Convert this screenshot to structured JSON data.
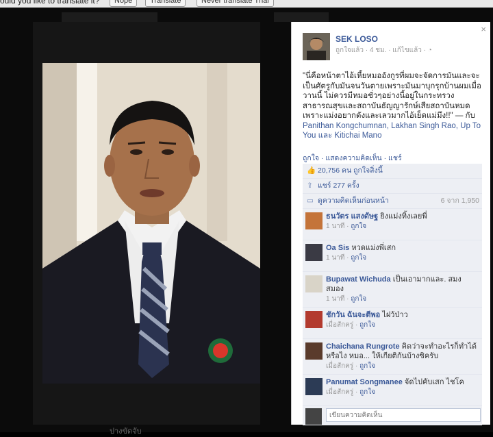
{
  "translate_bar": {
    "question": "ould you like to translate it?",
    "nope": "Nope",
    "translate": "Translate",
    "never": "Never translate Thai"
  },
  "stage": {
    "bottom_text": "ปางขัดจับ"
  },
  "post": {
    "close": "×",
    "author": "SEK LOSO",
    "meta": "ถูกใจแล้ว · 4 ชม. · แก้ไขแล้ว · ◔",
    "caption": "\"นี่คือหน้าตาไอ้เหี้ยหมออังกูรที่ผมจะจัดการมันและจะเป็นศัตรูกับมันจนวันตายเพราะมันมาบุกรุกบ้านผมเมื่อวานนี้ ไม่ควรมีหมอชั่วๆอย่างนี้อยู่ในกระทรวงสาธารณสุขและสถาบันธัญญารักษ์เสียสถาบันหมดเพราะแม่งอยากดังและเลวมากไอ้เย็ดแม่มึง!!\" — กับ",
    "tags": "Panithan Kongchumnan, Lakhan Singh Rao, Up To You และ Kitichai Mano",
    "actions": "ถูกใจ · แสดงความคิดเห็น · แชร์"
  },
  "ufi": {
    "likes": "20,756 คน ถูกใจสิ่งนี้",
    "shares": "แชร์ 277 ครั้ง",
    "view_prev": "ดูความคิดเห็นก่อนหน้า",
    "count": "6 จาก 1,950",
    "compose_placeholder": "เขียนความคิดเห็น"
  },
  "comments": [
    {
      "name": "ธนวัตร แสงดัษฐ",
      "text": "ยิงแม่งทิ้งเลยพี่",
      "time": "1 นาที",
      "like": "ถูกใจ"
    },
    {
      "name": "Oa Sis",
      "text": "หวดแม่งพี่เสก",
      "time": "1 นาที",
      "like": "ถูกใจ"
    },
    {
      "name": "Bupawat Wichuda",
      "text": "เป็นเอามากและ. สมงสมอง",
      "time": "1 นาที",
      "like": "ถูกใจ"
    },
    {
      "name": "ชักวัน ฉันจะตีพอ",
      "text": "ไฝว้ป่าว",
      "time": "เมื่อสักครู่",
      "like": "ถูกใจ"
    },
    {
      "name": "Chaichana Rungrote",
      "text": "คิดว่าจะทำอะไรก็ทำได้ หรือไง หมอ... ให้เกียติกันบ้างซิครับ",
      "time": "เมื่อสักครู่",
      "like": "ถูกใจ"
    },
    {
      "name": "Panumat Songmanee",
      "text": "จัดไปคับเสก ไชโค",
      "time": "เมื่อสักครู่",
      "like": "ถูกใจ"
    }
  ],
  "icons": {
    "like": "thumb-up-icon",
    "share": "share-icon",
    "comment": "comment-bubble-icon"
  }
}
